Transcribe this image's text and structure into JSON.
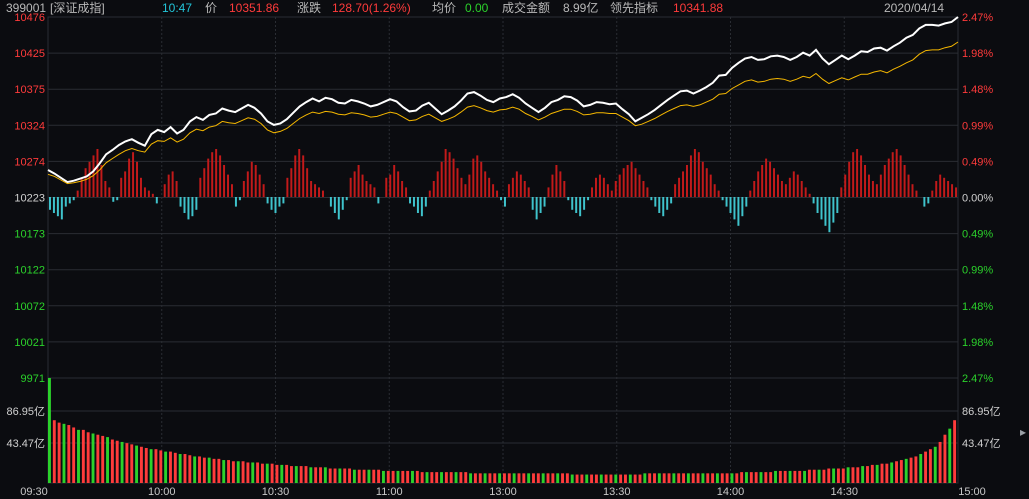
{
  "header": {
    "code": "399001",
    "name": "[深证成指]",
    "time": "10:47",
    "price_label": "价",
    "price": "10351.86",
    "change_label": "涨跌",
    "change": "128.70(1.26%)",
    "avg_label": "均价",
    "avg": "0.00",
    "amount_label": "成交金额",
    "amount": "8.99亿",
    "lead_label": "领先指标",
    "lead": "10341.88",
    "date": "2020/04/14"
  },
  "colors": {
    "background": "#0b0c10",
    "grid": "#2a2d33",
    "up": "#ff3b3b",
    "down": "#2bd22b",
    "index_line": "#ffffff",
    "lead_line": "#f5b700",
    "macd_up": "#c21a1a",
    "macd_down": "#3fc3cc"
  },
  "chart_data": {
    "type": "line",
    "title": "",
    "xlabel": "",
    "ylabel": "",
    "x_ticks": [
      "09:30",
      "10:00",
      "10:30",
      "11:00",
      "13:00",
      "13:30",
      "14:00",
      "14:30",
      "15:00"
    ],
    "price_ticks": [
      "10476",
      "10425",
      "10375",
      "10324",
      "10274",
      "10223",
      "10173",
      "10122",
      "10072",
      "10021",
      "9971"
    ],
    "pct_ticks": [
      "2.47%",
      "1.98%",
      "1.48%",
      "0.99%",
      "0.49%",
      "0.00%",
      "0.49%",
      "0.99%",
      "1.48%",
      "1.98%",
      "2.47%"
    ],
    "volume_ticks": [
      "86.95亿",
      "43.47亿"
    ],
    "prev_close": 10223,
    "ylim": [
      9971,
      10476
    ],
    "series": [
      {
        "values": [
          10262,
          10257,
          10251,
          10245,
          10247,
          10250,
          10253,
          10260,
          10271,
          10284,
          10290,
          10297,
          10302,
          10305,
          10300,
          10296,
          10312,
          10318,
          10315,
          10322,
          10313,
          10318,
          10330,
          10336,
          10332,
          10339,
          10341,
          10348,
          10345,
          10343,
          10348,
          10353,
          10349,
          10341,
          10330,
          10325,
          10327,
          10333,
          10342,
          10351,
          10357,
          10362,
          10358,
          10363,
          10361,
          10356,
          10355,
          10360,
          10358,
          10355,
          10351,
          10353,
          10357,
          10361,
          10358,
          10350,
          10344,
          10345,
          10352,
          10356,
          10348,
          10340,
          10345,
          10351,
          10359,
          10369,
          10371,
          10366,
          10360,
          10357,
          10362,
          10364,
          10368,
          10363,
          10355,
          10349,
          10343,
          10349,
          10357,
          10360,
          10365,
          10364,
          10359,
          10351,
          10353,
          10357,
          10356,
          10354,
          10355,
          10347,
          10340,
          10330,
          10335,
          10340,
          10346,
          10353,
          10360,
          10366,
          10372,
          10373,
          10369,
          10373,
          10378,
          10384,
          10394,
          10395,
          10405,
          10412,
          10418,
          10420,
          10416,
          10417,
          10421,
          10422,
          10420,
          10416,
          10420,
          10426,
          10422,
          10430,
          10418,
          10410,
          10416,
          10422,
          10417,
          10422,
          10428,
          10427,
          10432,
          10433,
          10429,
          10435,
          10440,
          10447,
          10451,
          10460,
          10465,
          10465,
          10464,
          10467,
          10469,
          10476
        ]
      },
      {
        "values": [
          10256,
          10253,
          10248,
          10243,
          10244,
          10246,
          10249,
          10254,
          10262,
          10272,
          10278,
          10284,
          10289,
          10292,
          10289,
          10287,
          10298,
          10303,
          10302,
          10307,
          10301,
          10305,
          10314,
          10319,
          10317,
          10322,
          10324,
          10330,
          10328,
          10327,
          10331,
          10335,
          10333,
          10327,
          10318,
          10314,
          10316,
          10320,
          10327,
          10334,
          10339,
          10343,
          10341,
          10344,
          10343,
          10340,
          10339,
          10342,
          10341,
          10339,
          10336,
          10337,
          10340,
          10343,
          10341,
          10336,
          10331,
          10332,
          10337,
          10340,
          10335,
          10330,
          10333,
          10337,
          10343,
          10350,
          10352,
          10349,
          10345,
          10343,
          10346,
          10347,
          10350,
          10347,
          10341,
          10337,
          10332,
          10336,
          10341,
          10344,
          10347,
          10347,
          10344,
          10339,
          10340,
          10342,
          10342,
          10341,
          10341,
          10336,
          10331,
          10324,
          10326,
          10330,
          10334,
          10339,
          10344,
          10348,
          10352,
          10353,
          10351,
          10353,
          10357,
          10361,
          10368,
          10369,
          10376,
          10381,
          10386,
          10388,
          10385,
          10386,
          10389,
          10390,
          10389,
          10386,
          10389,
          10393,
          10391,
          10397,
          10389,
          10383,
          10387,
          10391,
          10388,
          10392,
          10396,
          10396,
          10399,
          10401,
          10398,
          10403,
          10407,
          10412,
          10416,
          10424,
          10429,
          10430,
          10430,
          10433,
          10435,
          10441
        ]
      }
    ],
    "macd": [
      -8,
      -10,
      -12,
      -14,
      -6,
      -4,
      -2,
      4,
      12,
      18,
      22,
      26,
      30,
      20,
      10,
      6,
      -3,
      -2,
      12,
      16,
      24,
      28,
      22,
      12,
      6,
      4,
      2,
      -4,
      0,
      8,
      14,
      16,
      10,
      -6,
      -10,
      -14,
      -12,
      -8,
      12,
      18,
      24,
      28,
      30,
      26,
      20,
      14,
      8,
      -6,
      -2,
      10,
      16,
      22,
      20,
      14,
      8,
      -4,
      -8,
      -10,
      -6,
      -4,
      12,
      18,
      26,
      30,
      26,
      18,
      10,
      8,
      6,
      4,
      0,
      -6,
      -10,
      -14,
      -8,
      -2,
      12,
      16,
      20,
      14,
      10,
      8,
      6,
      -4,
      0,
      12,
      14,
      20,
      16,
      10,
      6,
      -4,
      -6,
      -10,
      -12,
      -6,
      4,
      10,
      16,
      22,
      30,
      28,
      24,
      18,
      12,
      8,
      14,
      24,
      26,
      22,
      16,
      12,
      8,
      4,
      -2,
      -6,
      8,
      12,
      16,
      14,
      10,
      6,
      -8,
      -14,
      -10,
      -6,
      6,
      14,
      20,
      16,
      10,
      -2,
      -8,
      -10,
      -12,
      -8,
      -2,
      6,
      12,
      14,
      12,
      8,
      4,
      10,
      14,
      18,
      20,
      22,
      18,
      14,
      10,
      6,
      -2,
      -6,
      -10,
      -12,
      -8,
      -4,
      8,
      12,
      16,
      20,
      26,
      30,
      28,
      22,
      18,
      14,
      8,
      4,
      -2,
      -6,
      -10,
      -14,
      -18,
      -12,
      -6,
      4,
      10,
      16,
      20,
      24,
      22,
      18,
      14,
      10,
      8,
      12,
      16,
      14,
      10,
      6,
      2,
      -4,
      -10,
      -14,
      -18,
      -22,
      -16,
      -10,
      6,
      14,
      22,
      28,
      30,
      26,
      20,
      14,
      10,
      8,
      14,
      20,
      24,
      28,
      30,
      26,
      20,
      14,
      8,
      4,
      0,
      -6,
      -4,
      4,
      10,
      14,
      12,
      10,
      8,
      6
    ],
    "volume": [
      86.95,
      52,
      50,
      49,
      48,
      46,
      44,
      44,
      42,
      41,
      40,
      39,
      38,
      36,
      35,
      34,
      33,
      32,
      31,
      30,
      29,
      28,
      28,
      27,
      26,
      26,
      25,
      24,
      24,
      23,
      22,
      22,
      21,
      21,
      20,
      20,
      19,
      19,
      18,
      18,
      18,
      17,
      17,
      17,
      16,
      16,
      16,
      15,
      15,
      15,
      14,
      14,
      14,
      14,
      13,
      13,
      13,
      13,
      12,
      12,
      12,
      12,
      12,
      11,
      11,
      11,
      11,
      11,
      11,
      10,
      10,
      10,
      10,
      10,
      10,
      10,
      10,
      9,
      9,
      9,
      9,
      9,
      9,
      9,
      9,
      9,
      9,
      8,
      8,
      8,
      8,
      8,
      8,
      8,
      8,
      8,
      8,
      8,
      8,
      8,
      8,
      8,
      8,
      8,
      8,
      8,
      8,
      8,
      7,
      7,
      7,
      7,
      7,
      7,
      7,
      7,
      7,
      7,
      7,
      7,
      7,
      7,
      7,
      8,
      8,
      8,
      8,
      8,
      8,
      8,
      8,
      8,
      8,
      8,
      8,
      8,
      8,
      8,
      8,
      8,
      8,
      8,
      8,
      9,
      9,
      9,
      9,
      9,
      9,
      9,
      10,
      10,
      10,
      10,
      10,
      10,
      10,
      11,
      11,
      11,
      11,
      12,
      12,
      12,
      12,
      13,
      13,
      13,
      14,
      14,
      15,
      15,
      16,
      16,
      17,
      18,
      19,
      20,
      21,
      22,
      24,
      26,
      28,
      30,
      34,
      40,
      45,
      52
    ]
  }
}
